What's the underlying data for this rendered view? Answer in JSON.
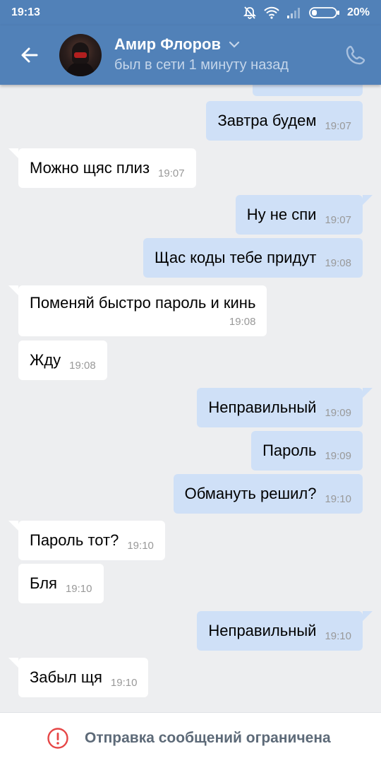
{
  "status_bar": {
    "time": "19:13",
    "battery": "20%"
  },
  "header": {
    "name": "Амир Флоров",
    "subtitle": "был в сети 1 минуту назад"
  },
  "messages": [
    {
      "dir": "out",
      "text": "Завтра будем",
      "time": "19:07"
    },
    {
      "dir": "in",
      "text": "Можно щяс плиз",
      "time": "19:07"
    },
    {
      "dir": "out",
      "text": "Ну не спи",
      "time": "19:07"
    },
    {
      "dir": "out",
      "text": "Щас коды тебе придут",
      "time": "19:08"
    },
    {
      "dir": "in",
      "text": "Поменяй быстро пароль и кинь",
      "time": "19:08"
    },
    {
      "dir": "in",
      "text": "Жду",
      "time": "19:08"
    },
    {
      "dir": "out",
      "text": "Неправильный",
      "time": "19:09"
    },
    {
      "dir": "out",
      "text": "Пароль",
      "time": "19:09"
    },
    {
      "dir": "out",
      "text": "Обмануть решил?",
      "time": "19:10"
    },
    {
      "dir": "in",
      "text": "Пароль тот?",
      "time": "19:10"
    },
    {
      "dir": "in",
      "text": "Бля",
      "time": "19:10"
    },
    {
      "dir": "out",
      "text": "Неправильный",
      "time": "19:10"
    },
    {
      "dir": "in",
      "text": "Забыл щя",
      "time": "19:10"
    }
  ],
  "footer": {
    "notice": "Отправка сообщений ограничена"
  },
  "colors": {
    "header": "#5181b8",
    "outgoing": "#cfe0f7",
    "incoming": "#ffffff",
    "background": "#edeef0",
    "warning": "#e64646"
  },
  "icons": [
    "muted-bell-icon",
    "wifi-icon",
    "signal-icon",
    "battery-icon",
    "back-arrow-icon",
    "chevron-down-icon",
    "phone-icon",
    "warning-icon"
  ]
}
